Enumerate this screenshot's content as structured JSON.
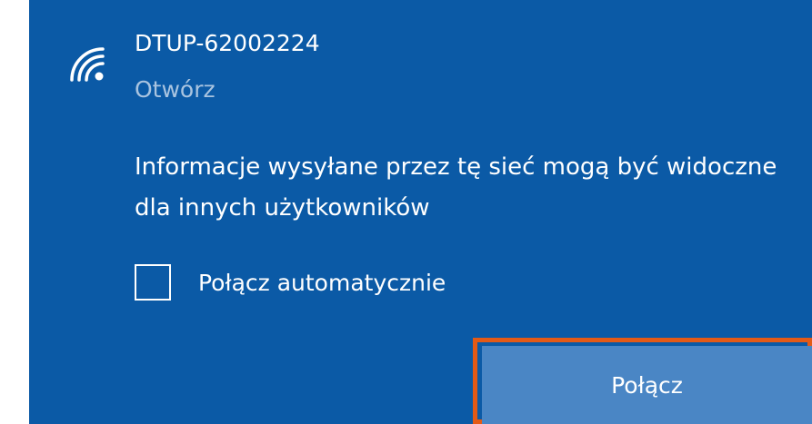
{
  "network": {
    "name": "DTUP-62002224",
    "status": "Otwórz",
    "icon": "wifi-signal-icon"
  },
  "warning_text": "Informacje wysyłane przez tę sieć mogą być widoczne dla innych użytkowników",
  "auto_connect": {
    "label": "Połącz automatycznie",
    "checked": false
  },
  "connect_button": {
    "label": "Połącz"
  },
  "colors": {
    "panel_background": "#0b5aa6",
    "button_background": "#4a86c5",
    "highlight_border": "#e35a17",
    "secondary_text": "#a9c4e0",
    "primary_text": "#ffffff"
  }
}
